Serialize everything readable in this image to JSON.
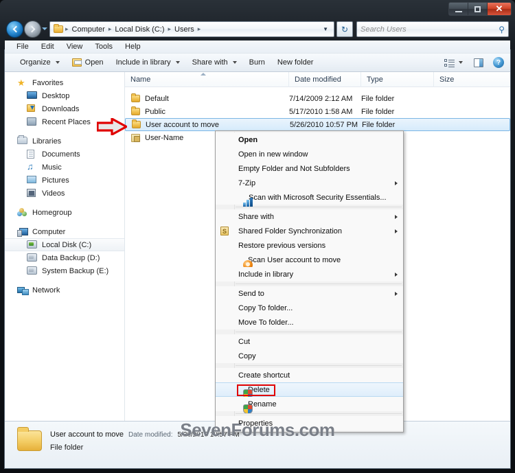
{
  "window": {
    "caption_buttons": [
      {
        "name": "minimize",
        "label": "–"
      },
      {
        "name": "maximize",
        "label": "□"
      },
      {
        "name": "close",
        "label": "✕"
      }
    ]
  },
  "address_bar": {
    "folder_icon": "folder-icon",
    "crumbs": [
      "Computer",
      "Local Disk (C:)",
      "Users"
    ],
    "separator": "▸",
    "dropdown_glyph": "▼",
    "refresh_glyph": "↻"
  },
  "search": {
    "placeholder": "Search Users",
    "icon": "search-icon",
    "icon_glyph": "⚲"
  },
  "menubar": {
    "items": [
      "File",
      "Edit",
      "View",
      "Tools",
      "Help"
    ]
  },
  "toolbar": {
    "organize_label": "Organize",
    "open_label": "Open",
    "include_label": "Include in library",
    "share_label": "Share with",
    "burn_label": "Burn",
    "newfolder_label": "New folder",
    "help_glyph": "?"
  },
  "navpane": {
    "groups": [
      {
        "root": {
          "label": "Favorites",
          "icon": "star-icon"
        },
        "children": [
          {
            "label": "Desktop",
            "icon": "desktop-icon"
          },
          {
            "label": "Downloads",
            "icon": "downloads-icon"
          },
          {
            "label": "Recent Places",
            "icon": "recent-places-icon"
          }
        ]
      },
      {
        "root": {
          "label": "Libraries",
          "icon": "library-icon"
        },
        "children": [
          {
            "label": "Documents",
            "icon": "document-icon"
          },
          {
            "label": "Music",
            "icon": "music-icon"
          },
          {
            "label": "Pictures",
            "icon": "picture-icon"
          },
          {
            "label": "Videos",
            "icon": "video-icon"
          }
        ]
      },
      {
        "root": {
          "label": "Homegroup",
          "icon": "homegroup-icon"
        },
        "children": []
      },
      {
        "root": {
          "label": "Computer",
          "icon": "computer-icon"
        },
        "children": [
          {
            "label": "Local Disk (C:)",
            "icon": "hard-disk-icon",
            "selected": true
          },
          {
            "label": "Data Backup (D:)",
            "icon": "drive-icon"
          },
          {
            "label": "System Backup (E:)",
            "icon": "drive-icon"
          }
        ]
      },
      {
        "root": {
          "label": "Network",
          "icon": "network-icon"
        },
        "children": []
      }
    ]
  },
  "filelist": {
    "columns": [
      "Name",
      "Date modified",
      "Type",
      "Size"
    ],
    "rows": [
      {
        "name": "Default",
        "date": "7/14/2009 2:12 AM",
        "type": "File folder",
        "size": "",
        "icon": "folder-icon",
        "selected": false
      },
      {
        "name": "Public",
        "date": "5/17/2010 1:58 AM",
        "type": "File folder",
        "size": "",
        "icon": "folder-icon",
        "selected": false
      },
      {
        "name": "User account to move",
        "date": "5/26/2010 10:57 PM",
        "type": "File folder",
        "size": "",
        "icon": "folder-icon",
        "selected": true
      },
      {
        "name": "User-Name",
        "date": "",
        "type": "",
        "size": "",
        "icon": "locked-folder-icon",
        "selected": false
      }
    ]
  },
  "context_menu": {
    "items": [
      {
        "label": "Open",
        "bold": true,
        "icon": null,
        "submenu": false
      },
      {
        "label": "Open in new window",
        "bold": false,
        "icon": null,
        "submenu": false
      },
      {
        "label": "Empty Folder and Not Subfolders",
        "bold": false,
        "icon": null,
        "submenu": false
      },
      {
        "label": "7-Zip",
        "bold": false,
        "icon": null,
        "submenu": true
      },
      {
        "label": "Scan with Microsoft Security Essentials...",
        "bold": false,
        "icon": "mse-icon",
        "submenu": false
      },
      {
        "separator": true
      },
      {
        "label": "Share with",
        "bold": false,
        "icon": null,
        "submenu": true
      },
      {
        "label": "Shared Folder Synchronization",
        "bold": false,
        "icon": "sync-icon",
        "submenu": true
      },
      {
        "label": "Restore previous versions",
        "bold": false,
        "icon": null,
        "submenu": false
      },
      {
        "label": "Scan User account to move",
        "bold": false,
        "icon": "scan-icon",
        "submenu": false
      },
      {
        "label": "Include in library",
        "bold": false,
        "icon": null,
        "submenu": true
      },
      {
        "separator": true
      },
      {
        "label": "Send to",
        "bold": false,
        "icon": null,
        "submenu": true
      },
      {
        "label": "Copy To folder...",
        "bold": false,
        "icon": null,
        "submenu": false
      },
      {
        "label": "Move To folder...",
        "bold": false,
        "icon": null,
        "submenu": false
      },
      {
        "separator": true
      },
      {
        "label": "Cut",
        "bold": false,
        "icon": null,
        "submenu": false
      },
      {
        "label": "Copy",
        "bold": false,
        "icon": null,
        "submenu": false
      },
      {
        "separator": true
      },
      {
        "label": "Create shortcut",
        "bold": false,
        "icon": null,
        "submenu": false
      },
      {
        "label": "Delete",
        "bold": false,
        "icon": "uac-shield-icon",
        "submenu": false,
        "hovered": true,
        "highlighted": true
      },
      {
        "label": "Rename",
        "bold": false,
        "icon": "uac-shield-icon",
        "submenu": false
      },
      {
        "separator": true
      },
      {
        "label": "Properties",
        "bold": false,
        "icon": null,
        "submenu": false
      }
    ]
  },
  "annotation": {
    "arrow_color": "#e00000",
    "highlight_box_color": "#e00000",
    "points_to": "User account to move"
  },
  "watermark": {
    "text": "SevenForums.com"
  },
  "details_pane": {
    "title": "User account to move",
    "date_label": "Date modified:",
    "date_value": "5/26/2010 10:57 PM",
    "type": "File folder",
    "icon": "folder-icon"
  },
  "colors": {
    "selection_blue": "#d6ebfb",
    "selection_border": "#7ab5e4",
    "annotation_red": "#e00000",
    "folder_yellow": "#f1c250",
    "accent": "#2878b5"
  }
}
